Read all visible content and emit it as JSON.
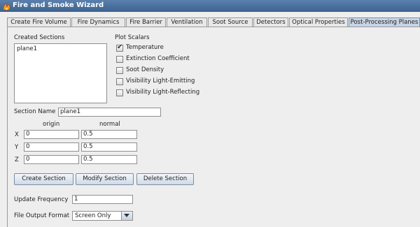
{
  "window": {
    "title": "Fire and Smoke Wizard"
  },
  "tabs": [
    {
      "label": "Create Fire Volume"
    },
    {
      "label": "Fire Dynamics"
    },
    {
      "label": "Fire Barrier"
    },
    {
      "label": "Ventilation"
    },
    {
      "label": "Soot Source"
    },
    {
      "label": "Detectors"
    },
    {
      "label": "Optical Properties"
    },
    {
      "label": "Post-Processing Planes",
      "active": true
    }
  ],
  "created_sections": {
    "label": "Created Sections",
    "items": [
      "plane1"
    ]
  },
  "plot_scalars": {
    "label": "Plot Scalars",
    "items": [
      {
        "label": "Temperature",
        "checked": true
      },
      {
        "label": "Extinction Coefficient",
        "checked": false
      },
      {
        "label": "Soot Density",
        "checked": false
      },
      {
        "label": "Visibility Light-Emitting",
        "checked": false
      },
      {
        "label": "Visibility Light-Reflecting",
        "checked": false
      }
    ]
  },
  "section_name": {
    "label": "Section Name",
    "value": "plane1"
  },
  "coords": {
    "origin_label": "origin",
    "normal_label": "normal",
    "rows": [
      {
        "axis": "X",
        "origin": "0",
        "normal": "0.5"
      },
      {
        "axis": "Y",
        "origin": "0",
        "normal": "0.5"
      },
      {
        "axis": "Z",
        "origin": "0",
        "normal": "0.5"
      }
    ]
  },
  "buttons": {
    "create": "Create Section",
    "modify": "Modify Section",
    "delete": "Delete Section"
  },
  "update_frequency": {
    "label": "Update Frequency",
    "value": "1"
  },
  "file_output_format": {
    "label": "File Output Format",
    "value": "Screen Only"
  }
}
